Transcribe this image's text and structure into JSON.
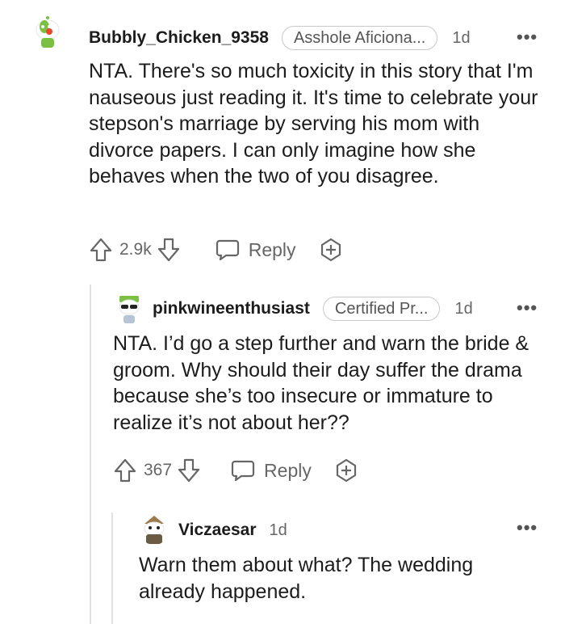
{
  "comments": [
    {
      "username": "Bubbly_Chicken_9358",
      "flair": "Asshole Aficiona...",
      "age": "1d",
      "more": "•••",
      "body": "NTA. There's so much toxicity in this story that I'm nauseous just reading it. It's time to celebrate your stepson's marriage by serving his mom with divorce papers. I can only imagine how she behaves when the two of you disagree.",
      "votes": "2.9k",
      "reply_label": "Reply"
    },
    {
      "username": "pinkwineenthusiast",
      "flair": "Certified Pr...",
      "age": "1d",
      "more": "•••",
      "body": "NTA. I’d go a step further and warn the bride & groom. Why should their day suffer the drama because she’s too insecure or immature to realize it’s not about her??",
      "votes": "367",
      "reply_label": "Reply"
    },
    {
      "username": "Viczaesar",
      "age": "1d",
      "more": "•••",
      "body": "Warn them about what? The wedding already happened."
    }
  ],
  "icons": {
    "upvote": "arrow-up-icon",
    "downvote": "arrow-down-icon",
    "reply": "chat-bubble-icon",
    "award": "add-award-icon"
  },
  "colors": {
    "text": "#1c1c1c",
    "muted": "#666666",
    "flair_border": "#c9c9c9",
    "thread_line": "#e0e0e0"
  }
}
